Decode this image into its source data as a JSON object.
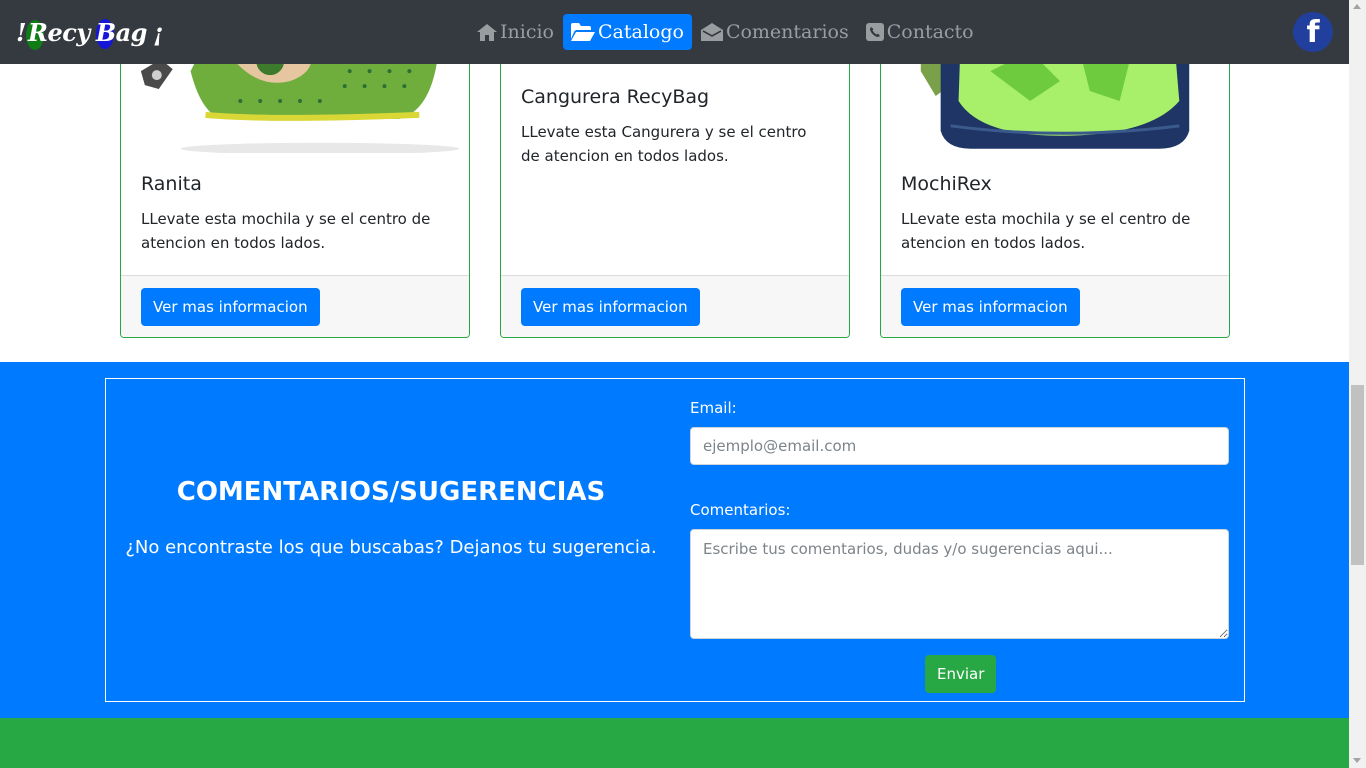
{
  "navbar": {
    "brand": {
      "open": "!",
      "word1": "Recy",
      "word2": "Bag",
      "close": "¡"
    },
    "items": [
      {
        "label": "Inicio",
        "icon": "home-icon",
        "active": false
      },
      {
        "label": "Catalogo",
        "icon": "folder-open-icon",
        "active": true
      },
      {
        "label": "Comentarios",
        "icon": "envelope-open-icon",
        "active": false
      },
      {
        "label": "Contacto",
        "icon": "phone-icon",
        "active": false
      }
    ],
    "social": {
      "icon": "facebook-icon",
      "glyph": "f"
    }
  },
  "catalog": {
    "cards": [
      {
        "title": "Ranita",
        "text": "LLevate esta mochila y se el centro de atencion en todos lados.",
        "button": "Ver mas informacion"
      },
      {
        "title": "Cangurera RecyBag",
        "text": "LLevate esta Cangurera y se el centro de atencion en todos lados.",
        "button": "Ver mas informacion"
      },
      {
        "title": "MochiRex",
        "text": "LLevate esta mochila y se el centro de atencion en todos lados.",
        "button": "Ver mas informacion"
      }
    ]
  },
  "feedback": {
    "title": "COMENTARIOS/SUGERENCIAS",
    "subtitle": "¿No encontraste los que buscabas? Dejanos tu sugerencia.",
    "email_label": "Email:",
    "email_placeholder": "ejemplo@email.com",
    "comments_label": "Comentarios:",
    "comments_placeholder": "Escribe tus comentarios, dudas y/o sugerencias aqui...",
    "submit": "Enviar"
  },
  "colors": {
    "navbar": "#343a40",
    "primary": "#007bff",
    "success": "#28a745",
    "facebook": "#213f9c"
  }
}
